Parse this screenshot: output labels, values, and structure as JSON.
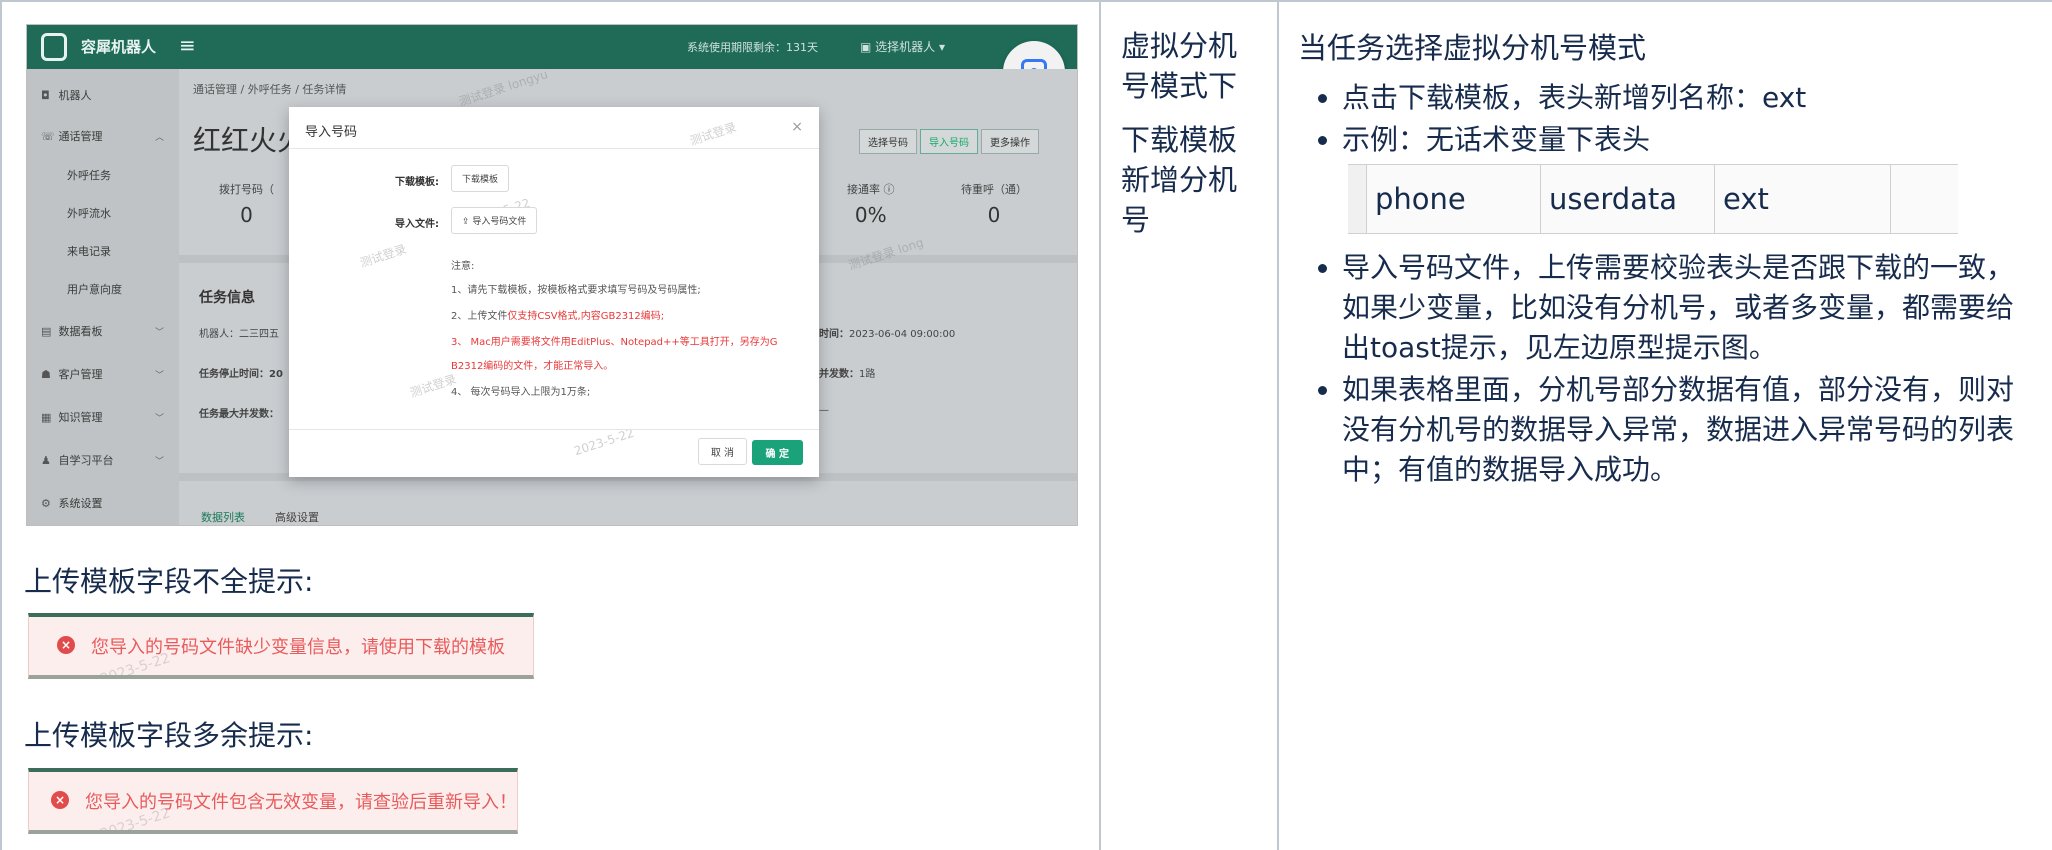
{
  "col1": {
    "screenshot": {
      "app_name": "容犀机器人",
      "system_notice": "系统使用期限剩余：131天",
      "select_robot": "选择机器人",
      "breadcrumb": "通话管理 / 外呼任务 / 任务详情",
      "page_title": "红红火火",
      "sidebar": {
        "items": [
          {
            "icon": "robot-icon",
            "label": "机器人"
          },
          {
            "icon": "phone-icon",
            "label": "通话管理"
          },
          {
            "icon": "chart-icon",
            "label": "数据看板"
          },
          {
            "icon": "users-icon",
            "label": "客户管理"
          },
          {
            "icon": "book-icon",
            "label": "知识管理"
          },
          {
            "icon": "learn-icon",
            "label": "自学习平台"
          },
          {
            "icon": "settings-icon",
            "label": "系统设置"
          }
        ],
        "sub_items": [
          "外呼任务",
          "外呼流水",
          "来电记录",
          "用户意向度"
        ]
      },
      "actions": [
        "选择号码",
        "导入号码",
        "更多操作"
      ],
      "stats": [
        {
          "label": "拨打号码（",
          "value": "0"
        },
        {
          "label": "接通率",
          "value": "0%"
        },
        {
          "label": "待重呼（通）",
          "value": "0"
        }
      ],
      "task_info": {
        "title": "任务信息",
        "robot": "机器人：二三四五",
        "stop_time": "任务停止时间：20",
        "max_concurrency": "任务最大并发数：",
        "time_label": "时间：",
        "time_value": "2023-06-04 09:00:00",
        "concurrency_label": "并发数：",
        "concurrency_value": "1路",
        "dash": "—"
      },
      "tabs": [
        "数据列表",
        "高级设置"
      ],
      "watermarks": [
        "测试登录 longyu",
        "2023-5-22",
        "测试登录",
        "2023-5-22",
        "测试登录 long",
        "2023-5-22"
      ],
      "modal": {
        "title": "导入号码",
        "close": "×",
        "download_label": "下载模板:",
        "download_button": "下载模板",
        "file_label": "导入文件:",
        "file_button": "⇪ 导入号码文件",
        "note_title": "注意:",
        "note1": "1、请先下载模板，按模板格式要求填写号码及号码属性;",
        "note2_prefix": "2、上传文件",
        "note2_red": "仅支持CSV格式,内容GB2312编码;",
        "note3a": "3、 Mac用户需要将文件用EditPlus、Notepad++等工具打开，另存为G",
        "note3b": "B2312编码的文件，才能正常导入。",
        "note4": "4、 每次号码导入上限为1万条;",
        "cancel": "取 消",
        "ok": "确 定"
      }
    },
    "label_missing": "上传模板字段不全提示:",
    "toast_missing": "您导入的号码文件缺少变量信息，请使用下载的模板",
    "label_extra": "上传模板字段多余提示:",
    "toast_extra": "您导入的号码文件包含无效变量，请查验后重新导入！",
    "toast_watermark": "2023-5-22",
    "toast_icon": "×"
  },
  "col2": {
    "line1": "虚拟分机号模式下",
    "line2": "下载模板新增分机号"
  },
  "col3": {
    "lead": "当任务选择虚拟分机号模式",
    "bullet1": "点击下载模板，表头新增列名称：ext",
    "bullet2": "示例：无话术变量下表头",
    "table_header": [
      "phone",
      "userdata",
      "ext"
    ],
    "bullet3": "导入号码文件，上传需要校验表头是否跟下载的一致，如果少变量，比如没有分机号，或者多变量，都需要给出toast提示，见左边原型提示图。",
    "bullet4": "如果表格里面，分机号部分数据有值，部分没有，则对没有分机号的数据导入异常，数据进入异常号码的列表中；有值的数据导入成功。"
  },
  "colors": {
    "app_green": "#1f6b58",
    "toast_bg": "#fdeeee",
    "toast_text": "#e85b5b",
    "accent_red": "#e83838",
    "ok_button": "#1aa37a"
  }
}
